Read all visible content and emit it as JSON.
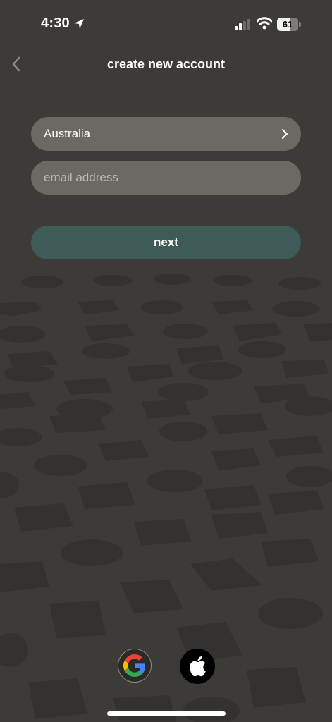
{
  "status_bar": {
    "time": "4:30",
    "battery_level": "61",
    "icons": [
      "location-arrow-icon",
      "signal-icon",
      "wifi-icon",
      "battery-icon"
    ]
  },
  "header": {
    "title": "create new account",
    "back_icon": "chevron-left-icon"
  },
  "form": {
    "country": {
      "value": "Australia",
      "icon": "chevron-right-icon"
    },
    "email": {
      "value": "",
      "placeholder": "email address"
    },
    "next_label": "next"
  },
  "social": {
    "providers": [
      "google-icon",
      "apple-icon"
    ]
  },
  "colors": {
    "background": "#3d3b37",
    "field": "#6b6964",
    "next_button": "#3f5b57",
    "text": "#ffffff"
  }
}
